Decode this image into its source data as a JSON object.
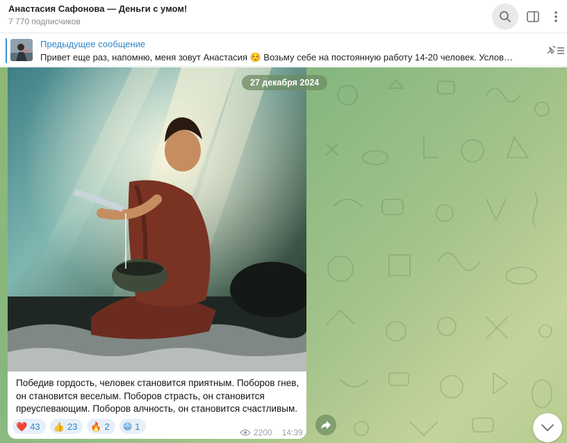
{
  "header": {
    "title": "Анастасия Сафонова — Деньги с умом!",
    "subscribers": "7 770 подписчиков"
  },
  "pinned": {
    "title": "Предыдущее сообщение",
    "text": "Привет еще раз, напомню, меня зовут Анастасия ☺️  Возьму себе на постоянную работу 14-20 человек.  Услов…"
  },
  "chat": {
    "date": "27 декабря 2024"
  },
  "message": {
    "caption": "Победив гордость, человек становится приятным. Поборов гнев, он становится веселым. Поборов страсть, он становится преуспевающим. Поборов алчность, он становится счастливым.",
    "reactions": [
      {
        "emoji": "❤️",
        "count": "43"
      },
      {
        "emoji": "👍",
        "count": "23"
      },
      {
        "emoji": "🔥",
        "count": "2"
      },
      {
        "emoji": "😁",
        "count": "1"
      }
    ],
    "views": "2200",
    "time": "14:39"
  },
  "icons": {
    "search": "search-icon",
    "sidebar": "sidebar-toggle-icon",
    "more": "more-vertical-icon",
    "unpin": "unpin-icon",
    "share": "share-icon",
    "scroll_down": "chevron-down-icon",
    "views": "eye-icon"
  },
  "colors": {
    "accent": "#2f86c9",
    "reaction_bg": "#e7f0f8",
    "chat_bg": "#8fb877"
  }
}
